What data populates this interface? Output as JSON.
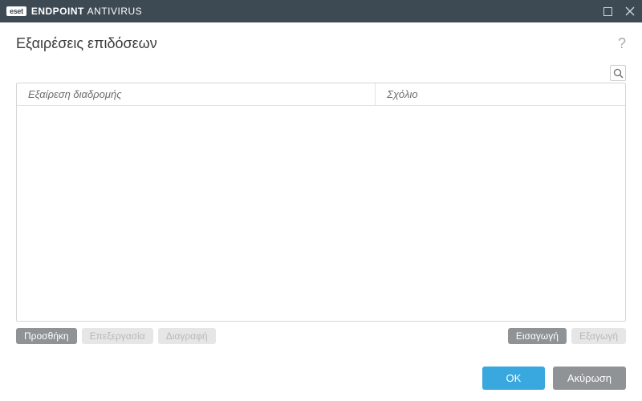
{
  "titlebar": {
    "brand_badge": "eset",
    "product_bold": "ENDPOINT ",
    "product_light": "ANTIVIRUS"
  },
  "header": {
    "title": "Εξαιρέσεις επιδόσεων"
  },
  "table": {
    "columns": {
      "path": "Εξαίρεση διαδρομής",
      "comment": "Σχόλιο"
    },
    "rows": []
  },
  "actions": {
    "add": "Προσθήκη",
    "edit": "Επεξεργασία",
    "delete": "Διαγραφή",
    "import": "Εισαγωγή",
    "export": "Εξαγωγή"
  },
  "footer": {
    "ok": "OK",
    "cancel": "Ακύρωση"
  }
}
